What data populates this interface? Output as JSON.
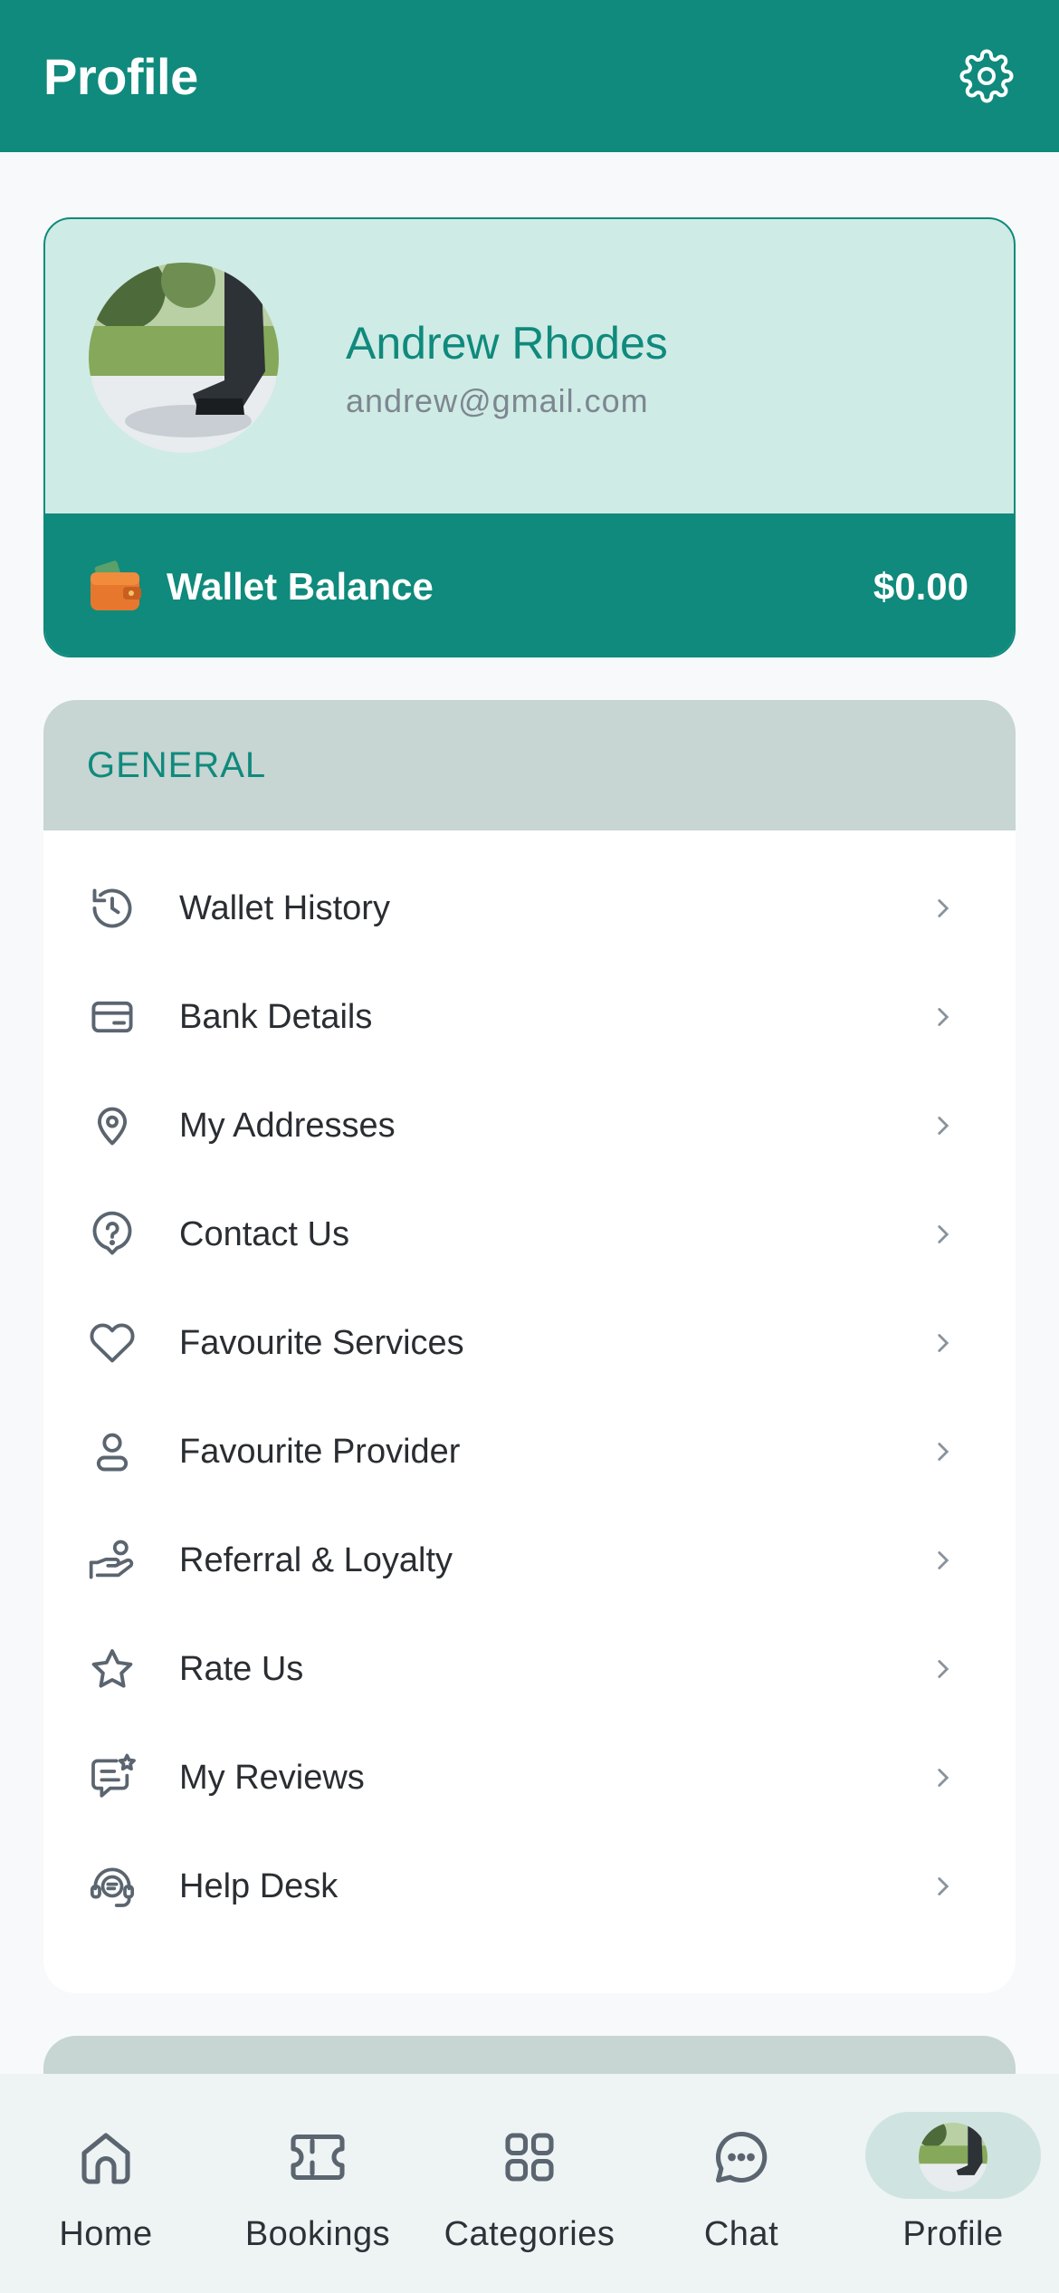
{
  "header": {
    "title": "Profile",
    "settings_icon": "gear-icon"
  },
  "profile": {
    "name": "Andrew Rhodes",
    "email": "andrew@gmail.com",
    "avatar": "user-photo"
  },
  "wallet": {
    "icon": "wallet-icon",
    "label": "Wallet Balance",
    "amount": "$0.00"
  },
  "general": {
    "title": "GENERAL",
    "items": [
      {
        "label": "Wallet History",
        "icon": "history-icon"
      },
      {
        "label": "Bank Details",
        "icon": "card-icon"
      },
      {
        "label": "My Addresses",
        "icon": "location-pin-icon"
      },
      {
        "label": "Contact Us",
        "icon": "help-circle-icon"
      },
      {
        "label": "Favourite Services",
        "icon": "heart-icon"
      },
      {
        "label": "Favourite Provider",
        "icon": "person-icon"
      },
      {
        "label": "Referral & Loyalty",
        "icon": "hand-coin-icon"
      },
      {
        "label": "Rate Us",
        "icon": "star-icon"
      },
      {
        "label": "My Reviews",
        "icon": "review-icon"
      },
      {
        "label": "Help Desk",
        "icon": "headset-icon"
      }
    ]
  },
  "bottom_nav": {
    "items": [
      {
        "label": "Home",
        "icon": "home-icon"
      },
      {
        "label": "Bookings",
        "icon": "ticket-icon"
      },
      {
        "label": "Categories",
        "icon": "grid-icon"
      },
      {
        "label": "Chat",
        "icon": "chat-icon"
      },
      {
        "label": "Profile",
        "icon": "avatar",
        "active": true
      }
    ]
  },
  "colors": {
    "primary": "#0f8a7c",
    "card_tint": "#cfebe6",
    "section_header": "#c7d5d3",
    "background": "#f7f9fb"
  }
}
